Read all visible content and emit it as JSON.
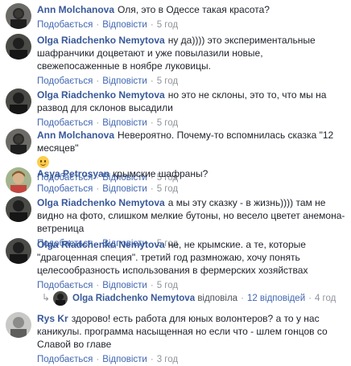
{
  "ui": {
    "like_label": "Подобається",
    "reply_label": "Відповісти",
    "dot": "·"
  },
  "comments": [
    {
      "author": "Ann Molchanova",
      "text": "Оля, это в Одессе такая красота?",
      "time": "5 год"
    },
    {
      "author": "Olga Riadchenko Nemytova",
      "text": "ну да)))) это экспериментальные шафранчики доцветают и уже повылазили новые, свежепосаженные в ноябре луковицы.",
      "time": "5 год"
    },
    {
      "author": "Olga Riadchenko Nemytova",
      "text": "но это не склоны, это то, что мы на развод для склонов высадили",
      "time": "5 год"
    },
    {
      "author": "Ann Molchanova",
      "text": "Невероятно. Почему-то вспомнилась сказка \"12 месяцев\"",
      "time": "5 год"
    },
    {
      "author": "Asya Petrosyan",
      "text": "крымские шафраны?",
      "time": "5 год"
    },
    {
      "author": "Olga Riadchenko Nemytova",
      "text": "а мы эту сказку - в жизнь)))) там не видно на фото, слишком мелкие бутоны, но весело цветет анемона-ветреница",
      "time": "5 год"
    },
    {
      "author": "Olga Riadchenko Nemytova",
      "text": "не, не крымские. а те, которые \"драгоценная специя\". третий год размножаю, хочу понять целесообразность использования в фермерских хозяйствах",
      "time": "5 год"
    },
    {
      "author": "Rys Kr",
      "text": "здорово! есть работа для юных волонтеров? а то у нас каникулы. программа насыщенная но если что - шлем гонцов со Славой во главе",
      "time": "3 год"
    }
  ],
  "reply_summary": {
    "author": "Olga Riadchenko Nemytova",
    "verb": "відповіла",
    "count_label": "12 відповідей",
    "time": "4 год"
  },
  "colors": {
    "author": "#385898",
    "link": "#4267b2",
    "muted": "#90949c"
  }
}
